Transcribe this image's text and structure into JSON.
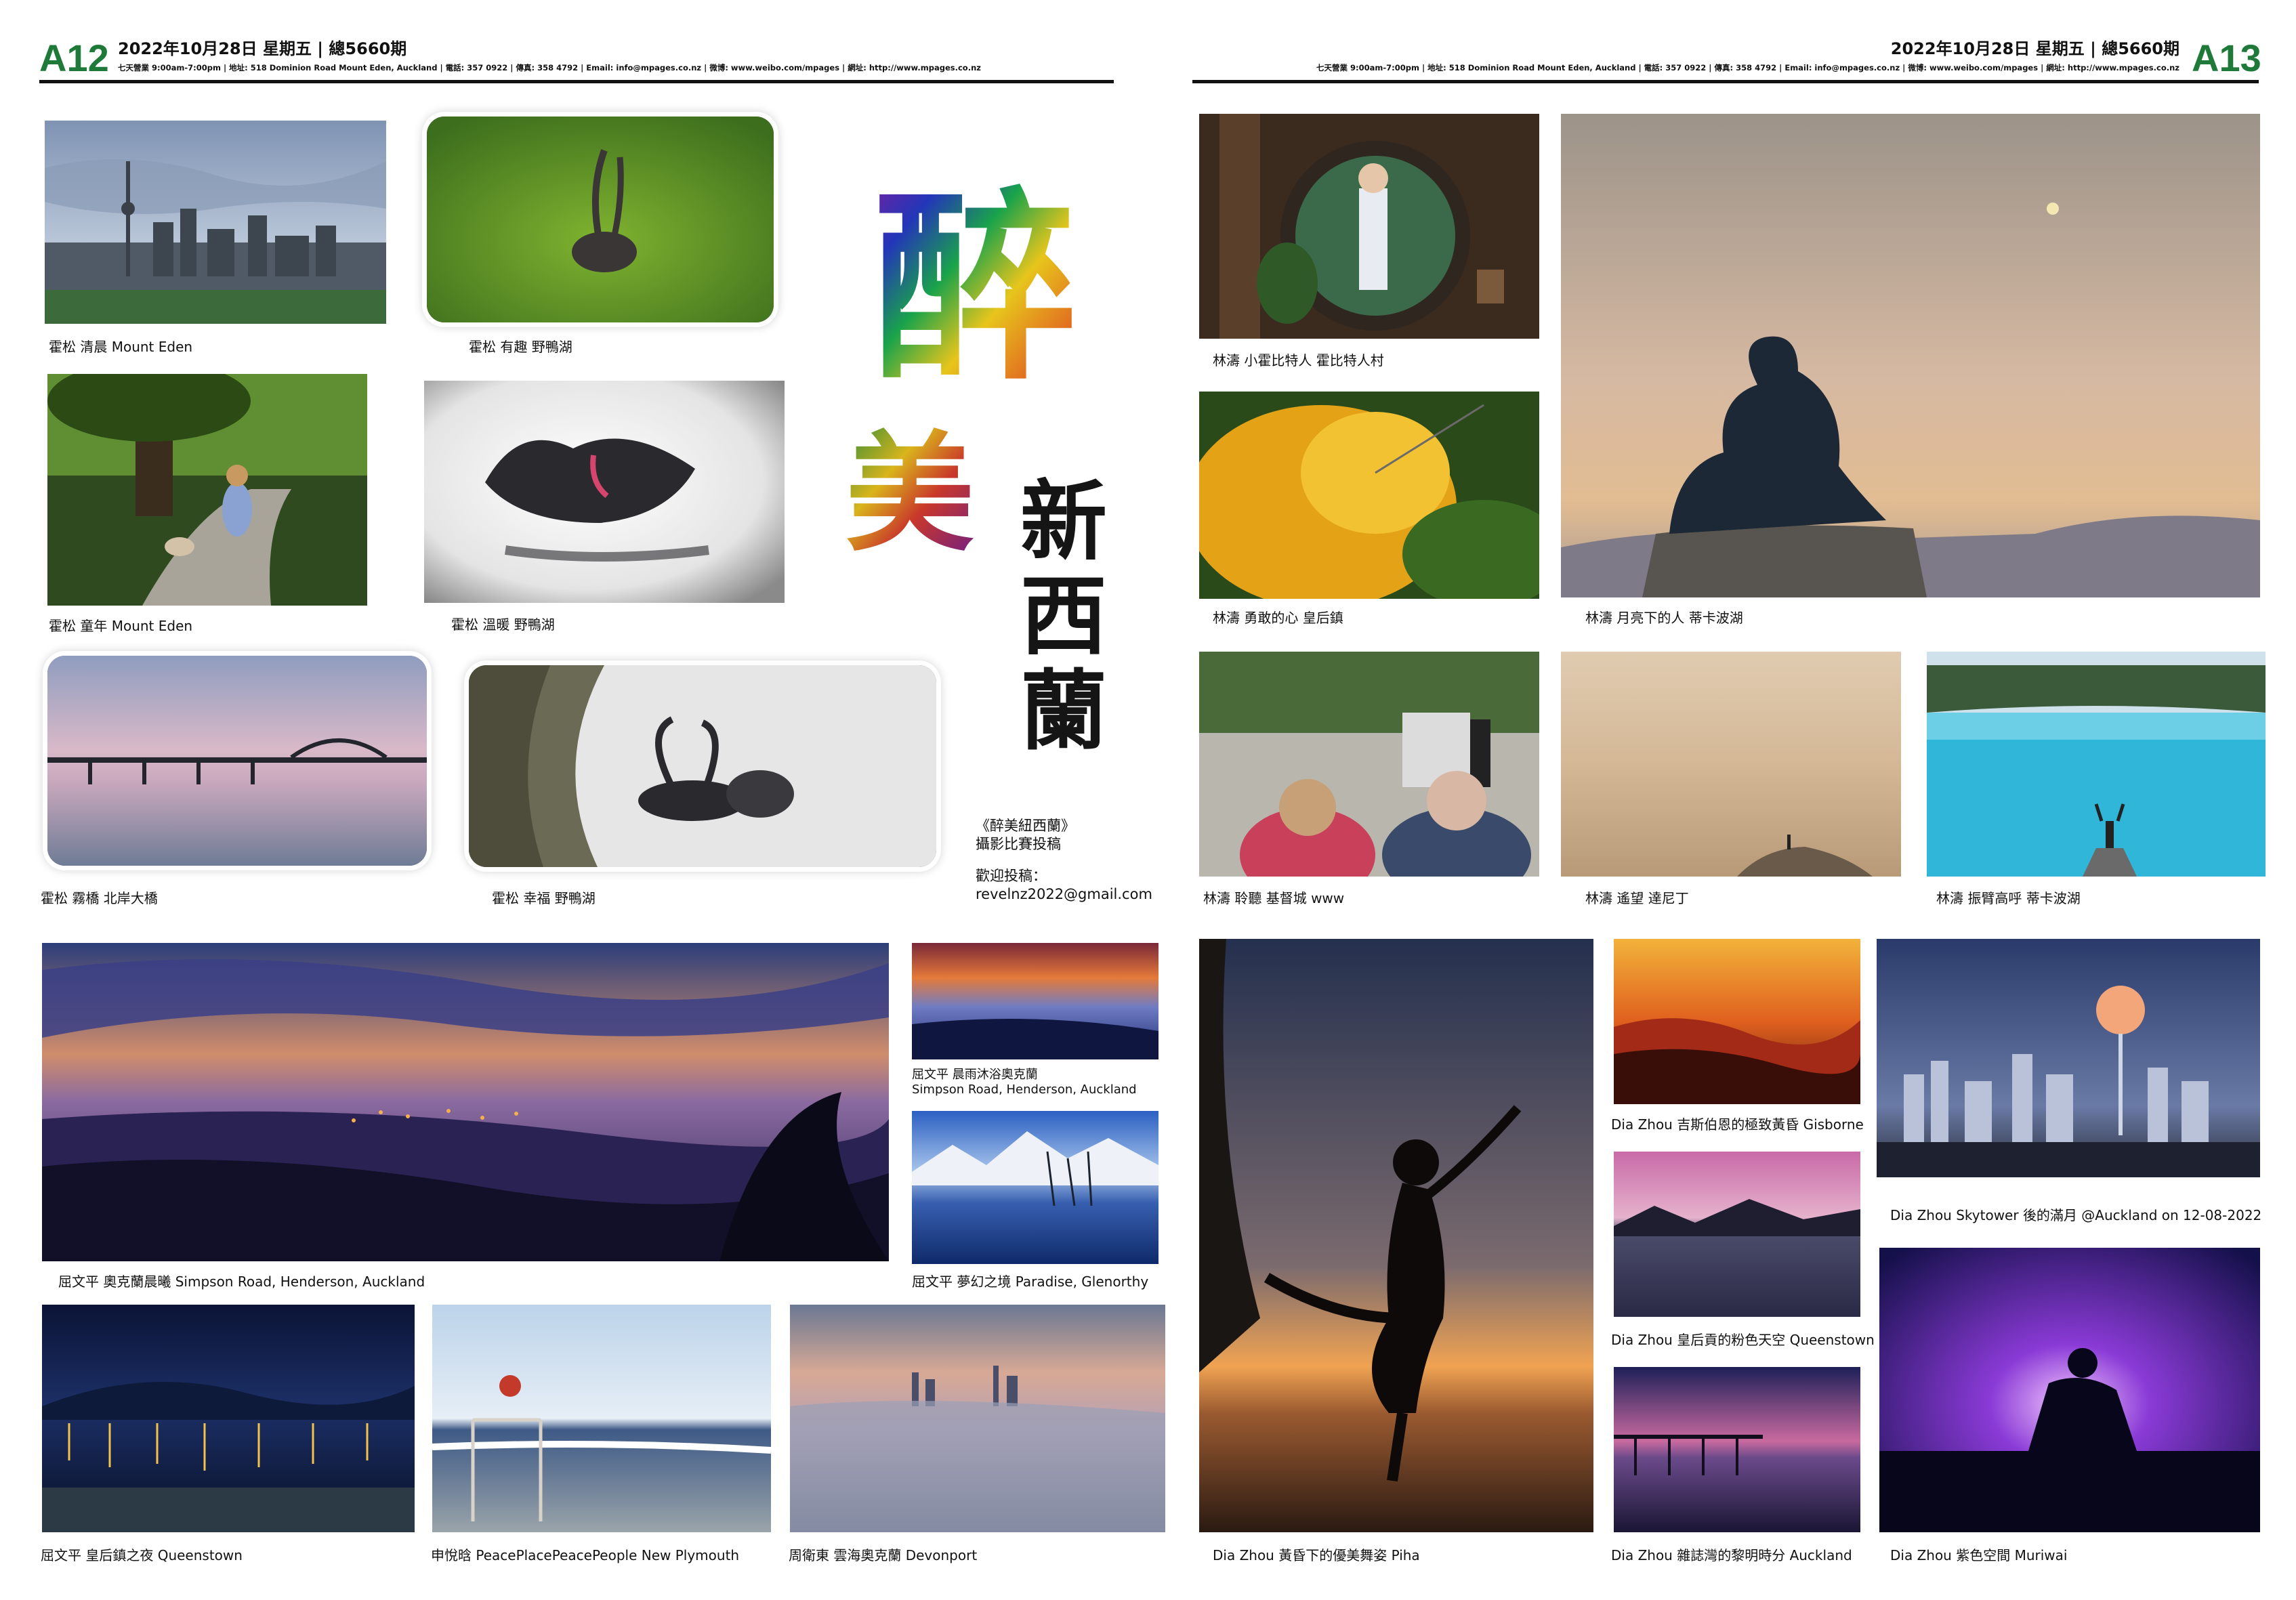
{
  "left_page": {
    "page_number": "A12",
    "date_line": "2022年10月28日  星期五 | 總5660期",
    "info_line": "七天營業 9:00am-7:00pm | 地址: 518 Dominion Road Mount Eden,  Auckland | 電話: 357 0922 | 傳真: 358 4792 | Email: info@mpages.co.nz | 微博: www.weibo.com/mpages | 網址: http://www.mpages.co.nz"
  },
  "right_page": {
    "page_number": "A13",
    "date_line": "2022年10月28日  星期五 | 總5660期",
    "info_line": "七天營業 9:00am-7:00pm | 地址: 518 Dominion Road Mount Eden,  Auckland | 電話: 357 0922 | 傳真: 358 4792 | Email: info@mpages.co.nz | 微博: www.weibo.com/mpages | 網址: http://www.mpages.co.nz"
  },
  "title": {
    "char_zui": "醉",
    "char_mei": "美",
    "vertical_chars": [
      "新",
      "西",
      "蘭"
    ]
  },
  "contest": {
    "line1": "《醉美紐西蘭》",
    "line2": "攝影比賽投稿",
    "line3": "歡迎投稿：",
    "email": "revelnz2022@gmail.com"
  },
  "captions": {
    "p1": "霍松 清晨 Mount Eden",
    "p2": "霍松 有趣 野鴨湖",
    "p3": "霍松 童年 Mount Eden",
    "p4": "霍松 溫暖 野鴨湖",
    "p5": "霍松 霧橋 北岸大橋",
    "p6": "霍松 幸福 野鴨湖",
    "p7": "屈文平 奧克蘭晨曦  Simpson Road, Henderson, Auckland",
    "p8a": "屈文平 晨雨沐浴奧克蘭",
    "p8b": "Simpson Road, Henderson, Auckland",
    "p9": "屈文平 夢幻之境 Paradise, Glenorthy",
    "p10": "屈文平 皇后鎮之夜 Queenstown",
    "p11": "申悅晗 PeacePlacePeacePeople New Plymouth",
    "p12": "周衛東 雲海奧克蘭 Devonport",
    "r1": "林濤 小霍比特人 霍比特人村",
    "r2": "林濤 月亮下的人 蒂卡波湖",
    "r3": "林濤 勇敢的心 皇后鎮",
    "r4": "林濤 聆聽 基督城 www",
    "r5": "林濤 遙望 達尼丁",
    "r6": "林濤 振臂高呼 蒂卡波湖",
    "r7": "Dia Zhou 黃昏下的優美舞姿 Piha",
    "r8": "Dia Zhou 吉斯伯恩的極致黃昏 Gisborne",
    "r9": "Dia Zhou  Skytower 後的滿月 @Auckland on 12-08-2022",
    "r10": "Dia Zhou  皇后貢的粉色天空 Queenstown",
    "r11": "Dia Zhou 雜誌灣的黎明時分 Auckland",
    "r12": "Dia Zhou 紫色空間 Muriwai"
  },
  "colors": {
    "page_number_green": "#1f7a3a",
    "rule": "#111111"
  },
  "icons": {
    "photo_signature": "signature-watermark-icon"
  }
}
